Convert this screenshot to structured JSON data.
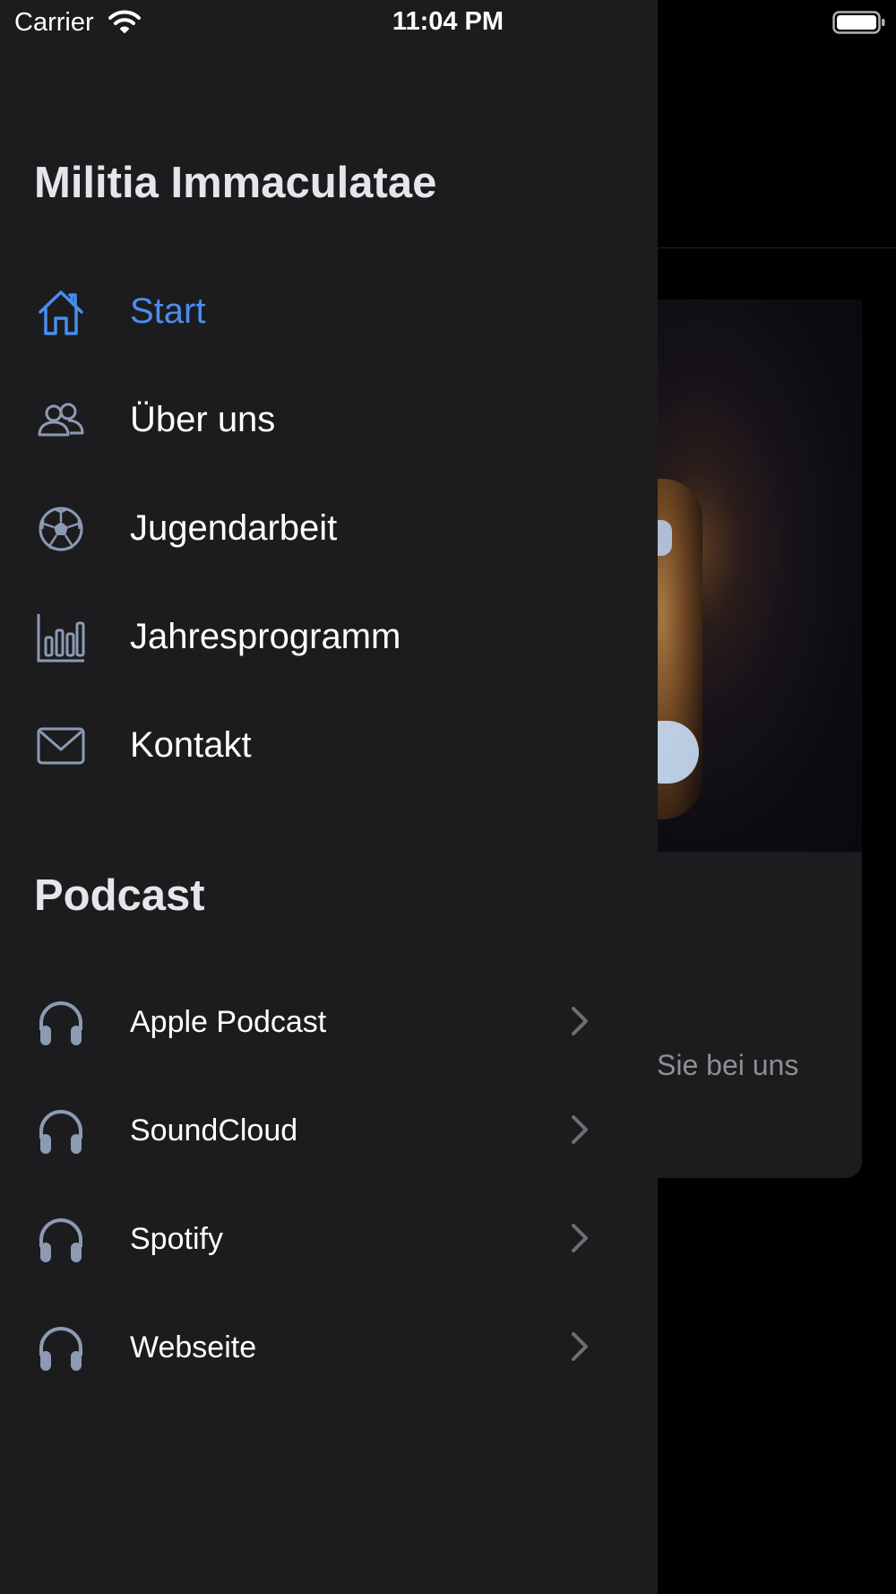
{
  "status_bar": {
    "carrier": "Carrier",
    "time": "11:04 PM"
  },
  "background": {
    "card_text": "Sie bei uns"
  },
  "drawer": {
    "title": "Militia Immaculatae",
    "nav_items": [
      {
        "label": "Start",
        "icon": "home-icon",
        "active": true
      },
      {
        "label": "Über uns",
        "icon": "people-icon",
        "active": false
      },
      {
        "label": "Jugendarbeit",
        "icon": "soccer-ball-icon",
        "active": false
      },
      {
        "label": "Jahresprogramm",
        "icon": "chart-icon",
        "active": false
      },
      {
        "label": "Kontakt",
        "icon": "envelope-icon",
        "active": false
      }
    ],
    "podcast_title": "Podcast",
    "podcast_items": [
      {
        "label": "Apple Podcast",
        "icon": "headphones-icon"
      },
      {
        "label": "SoundCloud",
        "icon": "headphones-icon"
      },
      {
        "label": "Spotify",
        "icon": "headphones-icon"
      },
      {
        "label": "Webseite",
        "icon": "headphones-icon"
      }
    ]
  },
  "colors": {
    "accent": "#4a8df0",
    "icon_gray": "#8c9ab4",
    "drawer_bg": "#1c1c1e"
  }
}
